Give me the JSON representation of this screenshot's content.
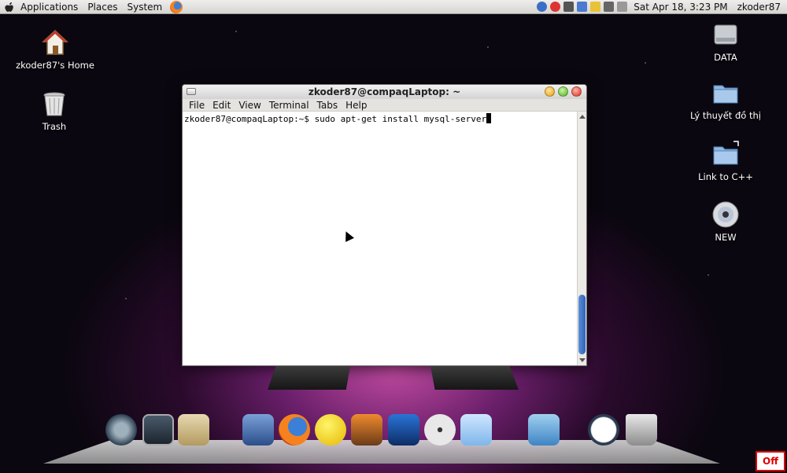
{
  "top_panel": {
    "menus": [
      "Applications",
      "Places",
      "System"
    ],
    "clock": "Sat Apr 18,  3:23 PM",
    "user": "zkoder87"
  },
  "desktop": {
    "icons_left": [
      {
        "label": "zkoder87's Home",
        "icon": "home-icon"
      },
      {
        "label": "Trash",
        "icon": "trash-icon"
      }
    ],
    "icons_right": [
      {
        "label": "DATA",
        "icon": "drive-icon"
      },
      {
        "label": "Lý thuyết đồ thị",
        "icon": "folder-icon"
      },
      {
        "label": "Link to C++",
        "icon": "folder-link-icon"
      },
      {
        "label": "NEW",
        "icon": "disc-icon"
      }
    ]
  },
  "window": {
    "title": "zkoder87@compaqLaptop: ~",
    "menus": [
      "File",
      "Edit",
      "View",
      "Terminal",
      "Tabs",
      "Help"
    ],
    "terminal_line": "zkoder87@compaqLaptop:~$ sudo apt-get install mysql-server"
  },
  "dock": {
    "icons": [
      "time-machine-icon",
      "activity-monitor-icon",
      "mail-stamp-icon",
      "preview-icon",
      "firefox-icon",
      "messenger-icon",
      "photo-icon",
      "movie-icon",
      "dvd-icon",
      "cloud-icon",
      "virtualbox-icon",
      "clock-icon",
      "dock-trash-icon"
    ]
  },
  "off_button": {
    "label": "Off"
  },
  "colors": {
    "accent_blue": "#2d63b8",
    "background": "#2a0a2c"
  }
}
